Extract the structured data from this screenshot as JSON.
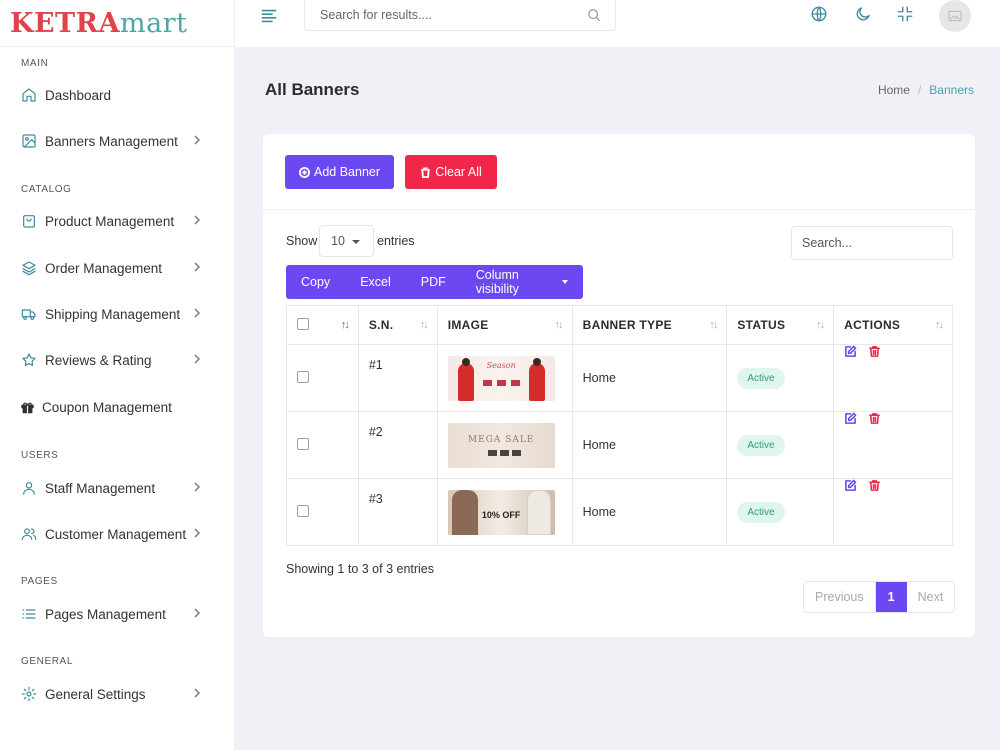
{
  "brand": {
    "part1": "KETRA",
    "part2": "mart"
  },
  "header": {
    "search_placeholder": "Search for results...."
  },
  "sidebar": {
    "sections": [
      "MAIN",
      "CATALOG",
      "USERS",
      "PAGES",
      "GENERAL"
    ],
    "items": [
      {
        "label": "Dashboard",
        "icon": "home-icon",
        "chevron": false
      },
      {
        "label": "Banners Management",
        "icon": "image-icon",
        "chevron": true
      },
      {
        "label": "Product Management",
        "icon": "shopping-bag-icon",
        "chevron": true
      },
      {
        "label": "Order Management",
        "icon": "layers-icon",
        "chevron": true
      },
      {
        "label": "Shipping Management",
        "icon": "truck-icon",
        "chevron": true
      },
      {
        "label": "Reviews & Rating",
        "icon": "star-icon",
        "chevron": true
      },
      {
        "label": "Coupon Management",
        "icon": "gift-icon",
        "chevron": false
      },
      {
        "label": "Staff Management",
        "icon": "user-icon",
        "chevron": true
      },
      {
        "label": "Customer Management",
        "icon": "users-icon",
        "chevron": true
      },
      {
        "label": "Pages Management",
        "icon": "list-icon",
        "chevron": true
      },
      {
        "label": "General Settings",
        "icon": "gear-icon",
        "chevron": true
      }
    ]
  },
  "page": {
    "title": "All Banners",
    "breadcrumb": {
      "home": "Home",
      "separator": "/",
      "current": "Banners"
    }
  },
  "toolbar": {
    "add_label": "Add Banner",
    "clear_label": "Clear All"
  },
  "table_controls": {
    "show_label": "Show",
    "entries_value": "10",
    "entries_label": "entries",
    "search_placeholder": "Search...",
    "export_buttons": [
      "Copy",
      "Excel",
      "PDF",
      "Column visibility"
    ]
  },
  "table": {
    "columns": [
      "S.N.",
      "IMAGE",
      "BANNER TYPE",
      "STATUS",
      "ACTIONS"
    ],
    "rows": [
      {
        "sn": "#1",
        "banner_type": "Home",
        "status": "Active"
      },
      {
        "sn": "#2",
        "banner_type": "Home",
        "status": "Active"
      },
      {
        "sn": "#3",
        "banner_type": "Home",
        "status": "Active"
      }
    ],
    "thumb_texts": {
      "t1": "Season",
      "t2": "MEGA SALE",
      "t3": "10% OFF"
    }
  },
  "footer": {
    "showing": "Showing 1 to 3 of 3 entries",
    "prev": "Previous",
    "page": "1",
    "next": "Next"
  },
  "colors": {
    "primary": "#6b48f2",
    "danger": "#f1274a",
    "accent": "#3c8c9b",
    "success_bg": "#dff5ef",
    "success_text": "#2d9c7a"
  }
}
